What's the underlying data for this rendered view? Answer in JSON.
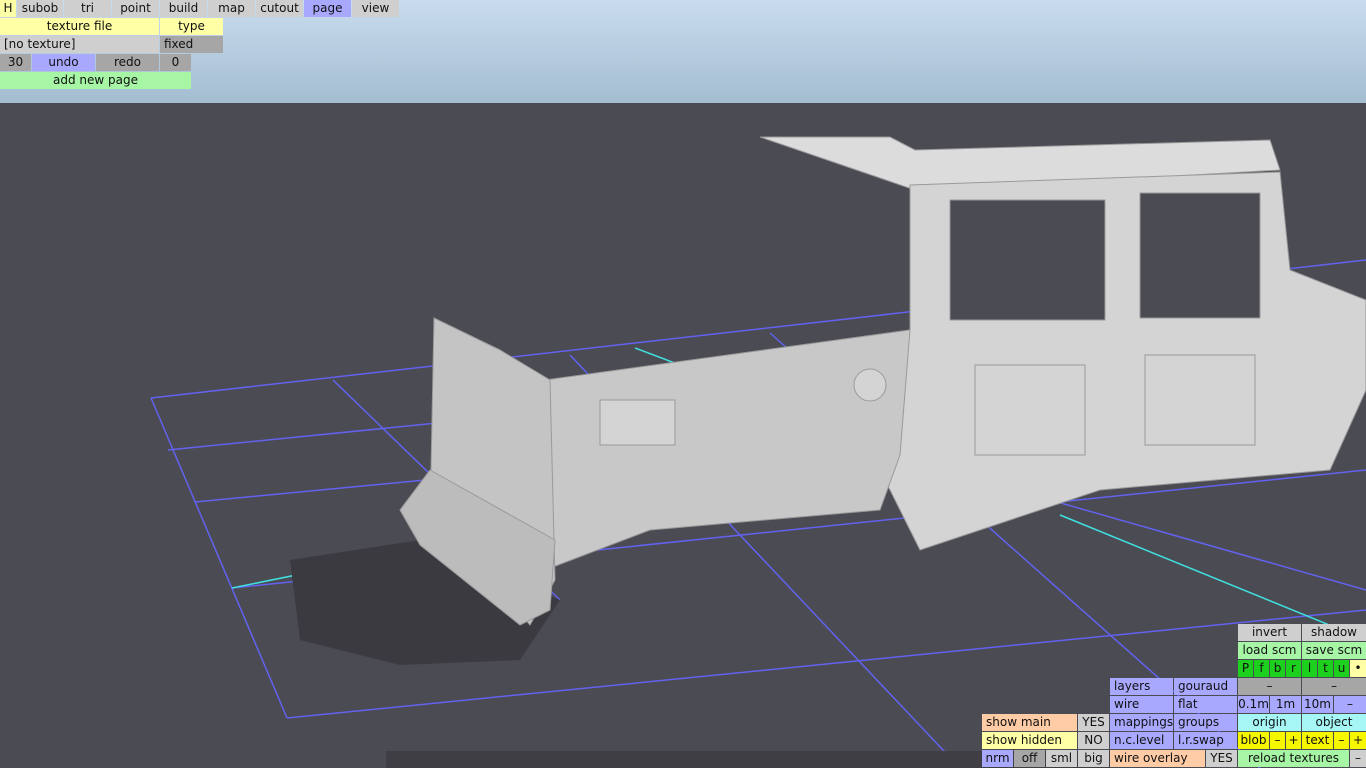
{
  "menu": {
    "h": "H",
    "items": [
      "subob",
      "tri",
      "point",
      "build",
      "map",
      "cutout",
      "page",
      "view"
    ],
    "active": "page"
  },
  "page_panel": {
    "texture_file": "texture file",
    "type": "type",
    "texture_value": "[no texture]",
    "type_value": "fixed",
    "undo_count": "30",
    "undo": "undo",
    "redo": "redo",
    "redo_count": "0",
    "add_new_page": "add new page"
  },
  "view_panel": {
    "invert": "invert",
    "shadow": "shadow",
    "load_scm": "load scm",
    "save_scm": "save scm",
    "views": [
      "P",
      "f",
      "b",
      "r",
      "l",
      "t",
      "u",
      "•"
    ],
    "dash1": "–",
    "dash2": "–",
    "grid": [
      "0.1m",
      "1m",
      "10m",
      "–"
    ],
    "origin": "origin",
    "object": "object",
    "blob": "blob",
    "blob_minus": "–",
    "blob_plus": "+",
    "text": "text",
    "text_minus": "–",
    "text_plus": "+",
    "reload_textures": "reload textures",
    "reload_minus": "–",
    "layers": "layers",
    "gouraud": "gouraud",
    "wire": "wire",
    "flat": "flat",
    "mappings": "mappings",
    "groups": "groups",
    "nc_level": "n.c.level",
    "lr_swap": "l.r.swap",
    "wire_overlay": "wire overlay",
    "wire_overlay_value": "YES",
    "show_main": "show main",
    "show_main_value": "YES",
    "show_hidden": "show hidden",
    "show_hidden_value": "NO",
    "sizes": [
      "nrm",
      "off",
      "sml",
      "big"
    ]
  },
  "colors": {
    "sky": "#b4cade",
    "ground": "#4b4b53",
    "grid": "#6a6aff",
    "axis": "#40e0e0",
    "model": "#d2d2d2"
  }
}
